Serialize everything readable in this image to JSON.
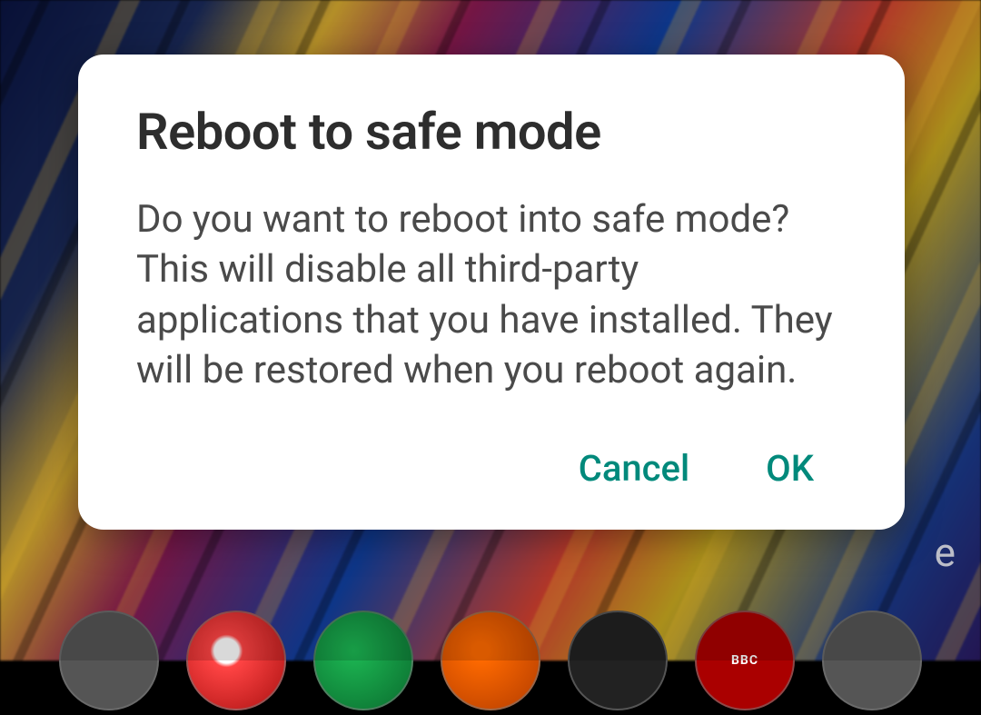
{
  "dialog": {
    "title": "Reboot to safe mode",
    "message": "Do you want to reboot into safe mode? This will disable all third-party applications that you have installed. They will be restored when you reboot again.",
    "cancel_label": "Cancel",
    "ok_label": "OK"
  },
  "colors": {
    "accent": "#00897b",
    "title_text": "#2d2d2d",
    "body_text": "#4a4a4a",
    "dialog_bg": "#ffffff"
  },
  "background": {
    "partial_text": "e",
    "dock_hint": "BBC"
  }
}
